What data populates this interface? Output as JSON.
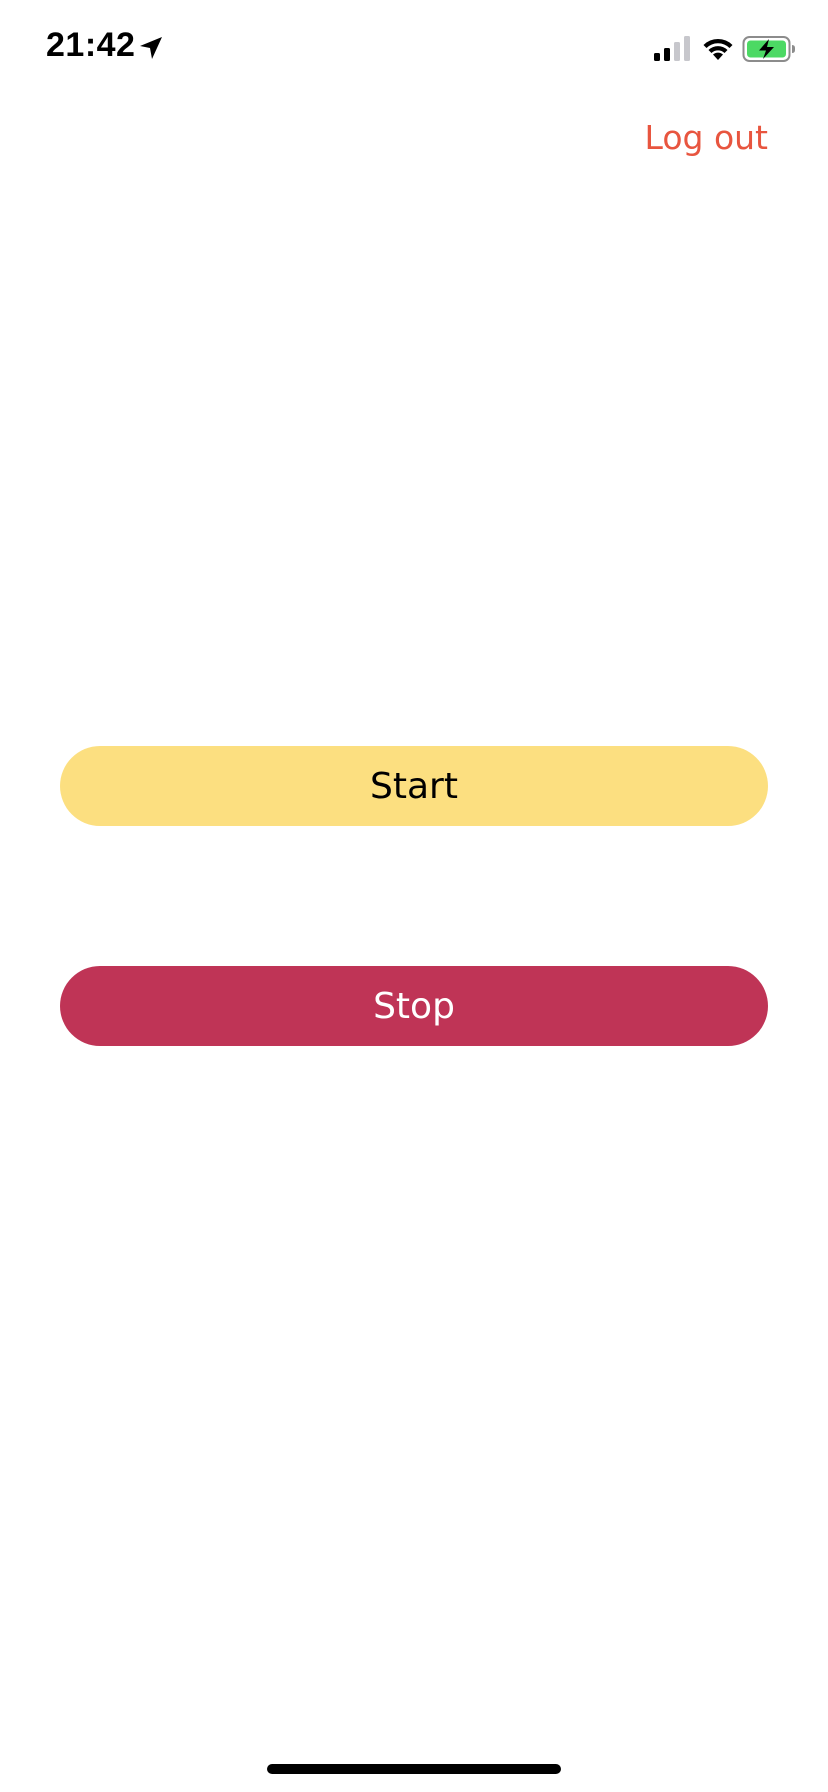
{
  "status_bar": {
    "time": "21:42",
    "icons": [
      "location-arrow-icon",
      "cellular-signal-icon",
      "wifi-icon",
      "battery-charging-icon"
    ],
    "battery_color": "#4cd964"
  },
  "header": {
    "logout_label": "Log out",
    "logout_color": "#e8553f"
  },
  "main": {
    "start_label": "Start",
    "start_color": "#fcdf80",
    "stop_label": "Stop",
    "stop_color": "#bf3456"
  }
}
